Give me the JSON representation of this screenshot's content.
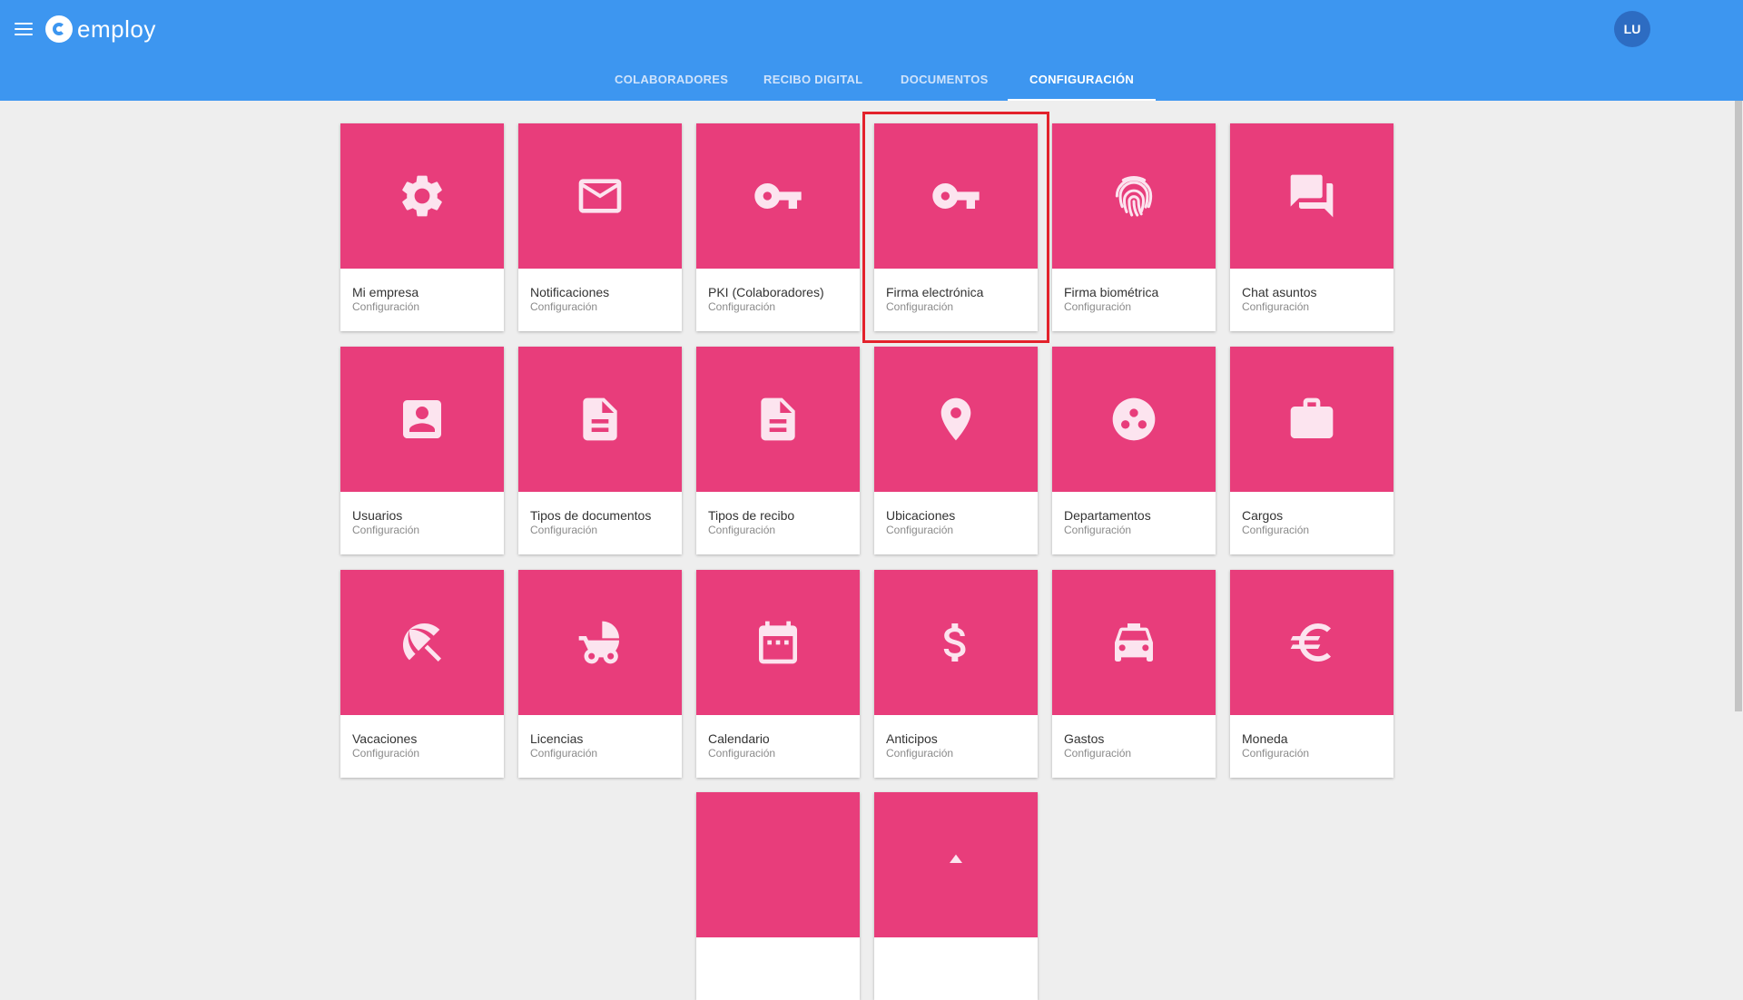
{
  "app": {
    "logo_text": "employ",
    "user_initials": "LU"
  },
  "tabs": [
    {
      "label": "COLABORADORES",
      "active": false
    },
    {
      "label": "RECIBO DIGITAL",
      "active": false
    },
    {
      "label": "DOCUMENTOS",
      "active": false
    },
    {
      "label": "CONFIGURACIÓN",
      "active": true
    }
  ],
  "cards": [
    {
      "title": "Mi empresa",
      "subtitle": "Configuración",
      "icon": "gear-icon"
    },
    {
      "title": "Notificaciones",
      "subtitle": "Configuración",
      "icon": "mail-icon"
    },
    {
      "title": "PKI (Colaboradores)",
      "subtitle": "Configuración",
      "icon": "key-icon"
    },
    {
      "title": "Firma electrónica",
      "subtitle": "Configuración",
      "icon": "key-icon",
      "highlighted": true
    },
    {
      "title": "Firma biométrica",
      "subtitle": "Configuración",
      "icon": "fingerprint-icon"
    },
    {
      "title": "Chat asuntos",
      "subtitle": "Configuración",
      "icon": "chat-icon"
    },
    {
      "title": "Usuarios",
      "subtitle": "Configuración",
      "icon": "contact-card-icon"
    },
    {
      "title": "Tipos de documentos",
      "subtitle": "Configuración",
      "icon": "document-icon"
    },
    {
      "title": "Tipos de recibo",
      "subtitle": "Configuración",
      "icon": "document-icon"
    },
    {
      "title": "Ubicaciones",
      "subtitle": "Configuración",
      "icon": "location-pin-icon"
    },
    {
      "title": "Departamentos",
      "subtitle": "Configuración",
      "icon": "bubble-chart-icon"
    },
    {
      "title": "Cargos",
      "subtitle": "Configuración",
      "icon": "briefcase-icon"
    },
    {
      "title": "Vacaciones",
      "subtitle": "Configuración",
      "icon": "beach-umbrella-icon"
    },
    {
      "title": "Licencias",
      "subtitle": "Configuración",
      "icon": "stroller-icon"
    },
    {
      "title": "Calendario",
      "subtitle": "Configuración",
      "icon": "calendar-icon"
    },
    {
      "title": "Anticipos",
      "subtitle": "Configuración",
      "icon": "dollar-icon"
    },
    {
      "title": "Gastos",
      "subtitle": "Configuración",
      "icon": "taxi-icon"
    },
    {
      "title": "Moneda",
      "subtitle": "Configuración",
      "icon": "euro-icon"
    }
  ],
  "partial_cards": [
    {
      "icon": "partial-icon"
    },
    {
      "icon": "partial-icon"
    }
  ]
}
